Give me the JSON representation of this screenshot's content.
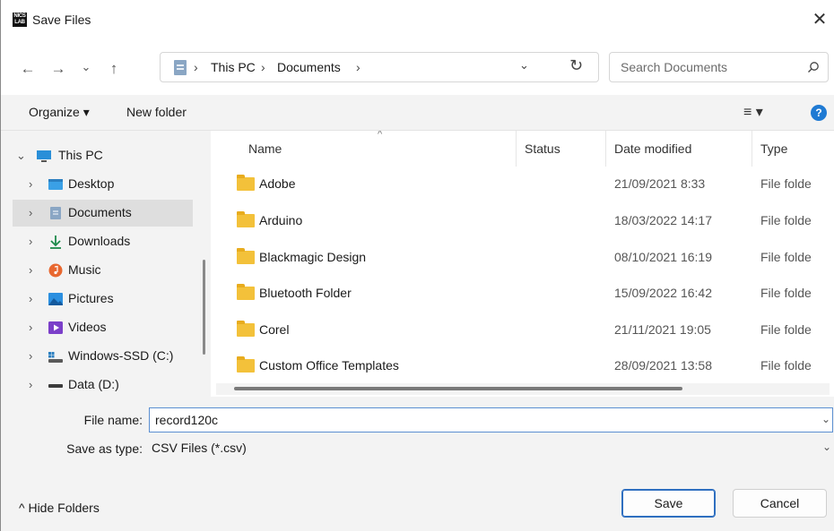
{
  "window": {
    "title": "Save Files",
    "app_icon_text": "NICS LAB",
    "close_glyph": "✕"
  },
  "nav": {
    "back_glyph": "←",
    "forward_glyph": "→",
    "recent_glyph": "⌄",
    "up_glyph": "↑",
    "breadcrumbs": [
      "This PC",
      "Documents"
    ],
    "crumb_sep": "›",
    "dropdown_glyph": "⌄",
    "refresh_glyph": "↻"
  },
  "search": {
    "placeholder": "Search Documents"
  },
  "toolbar": {
    "organize_label": "Organize ▾",
    "new_folder_label": "New folder",
    "view_glyph": "≡ ▾",
    "help_glyph": "?"
  },
  "sidebar": {
    "items": [
      {
        "label": "This PC",
        "icon": "monitor-icon",
        "chevron": "⌄"
      },
      {
        "label": "Desktop",
        "icon": "desktop-icon",
        "chevron": "›"
      },
      {
        "label": "Documents",
        "icon": "documents-icon",
        "chevron": "›",
        "selected": true
      },
      {
        "label": "Downloads",
        "icon": "download-icon",
        "chevron": "›"
      },
      {
        "label": "Music",
        "icon": "music-icon",
        "chevron": "›"
      },
      {
        "label": "Pictures",
        "icon": "pictures-icon",
        "chevron": "›"
      },
      {
        "label": "Videos",
        "icon": "videos-icon",
        "chevron": "›"
      },
      {
        "label": "Windows-SSD (C:)",
        "icon": "drive-c-icon",
        "chevron": "›"
      },
      {
        "label": "Data (D:)",
        "icon": "drive-d-icon",
        "chevron": "›"
      }
    ]
  },
  "filelist": {
    "columns": [
      "Name",
      "Status",
      "Date modified",
      "Type"
    ],
    "sort_glyph": "^",
    "rows": [
      {
        "name": "Adobe",
        "date": "21/09/2021 8:33",
        "type": "File folde"
      },
      {
        "name": "Arduino",
        "date": "18/03/2022 14:17",
        "type": "File folde"
      },
      {
        "name": "Blackmagic Design",
        "date": "08/10/2021 16:19",
        "type": "File folde"
      },
      {
        "name": "Bluetooth Folder",
        "date": "15/09/2022 16:42",
        "type": "File folde"
      },
      {
        "name": "Corel",
        "date": "21/11/2021 19:05",
        "type": "File folde"
      },
      {
        "name": "Custom Office Templates",
        "date": "28/09/2021 13:58",
        "type": "File folde"
      }
    ]
  },
  "form": {
    "file_name_label": "File name:",
    "file_name_value": "record120c",
    "save_type_label": "Save as type:",
    "save_type_value": "CSV Files (*.csv)",
    "dropdown_glyph": "⌄",
    "hide_folders_label": "^  Hide Folders",
    "save_label": "Save",
    "cancel_label": "Cancel"
  },
  "colors": {
    "accent": "#1f7ad3",
    "folder": "#f3c13a",
    "selection": "#dedede"
  }
}
